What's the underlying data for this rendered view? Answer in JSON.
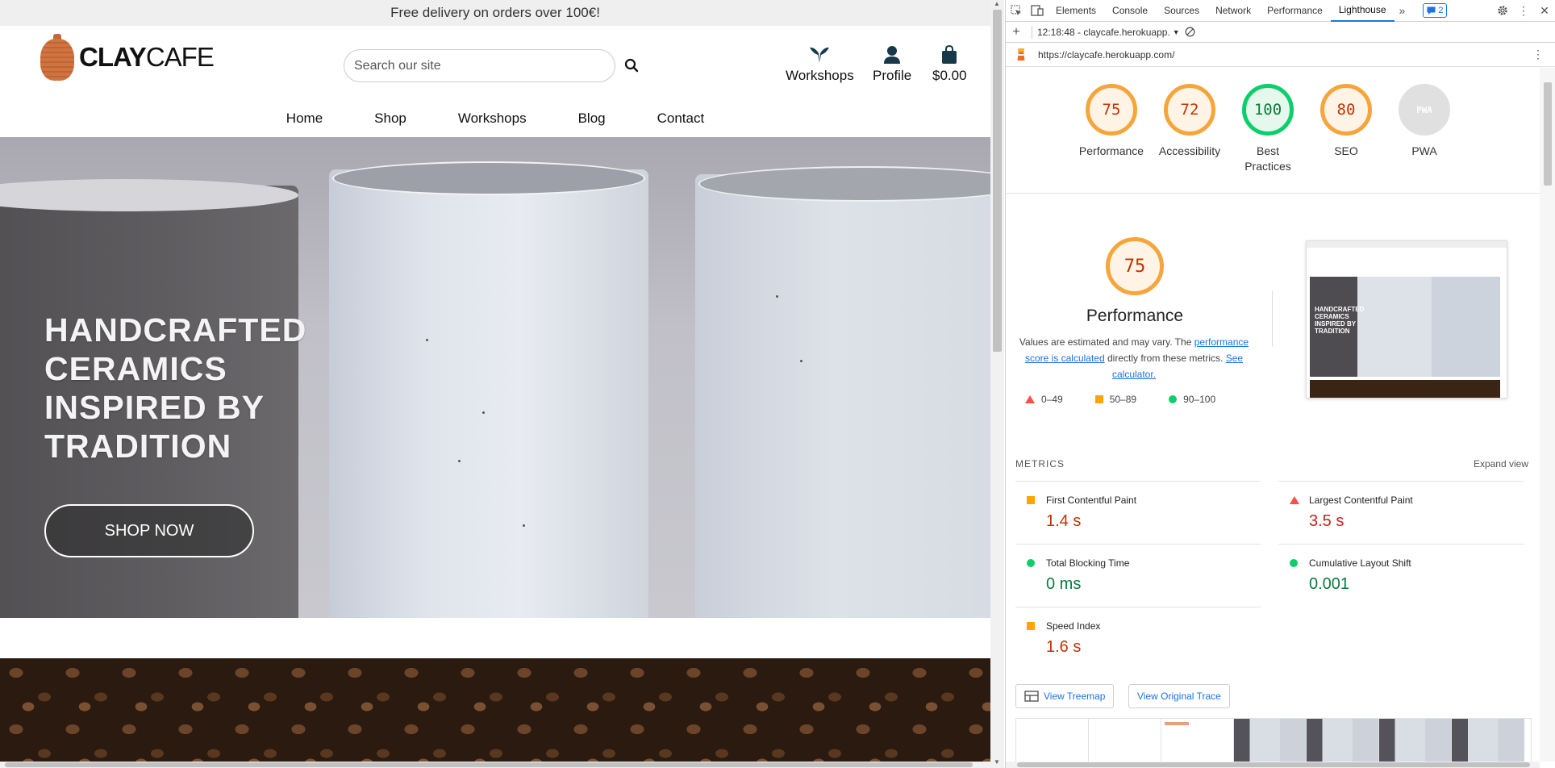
{
  "site": {
    "banner": "Free delivery on orders over 100€!",
    "logo": {
      "bold": "CLAY",
      "light": "CAFE"
    },
    "search": {
      "placeholder": "Search our site"
    },
    "actions": {
      "workshops": "Workshops",
      "profile": "Profile",
      "bag_total": "$0.00"
    },
    "nav": [
      "Home",
      "Shop",
      "Workshops",
      "Blog",
      "Contact"
    ],
    "hero": {
      "title_lines": [
        "HANDCRAFTED",
        "CERAMICS",
        "INSPIRED BY",
        "TRADITION"
      ],
      "cta": "SHOP NOW"
    }
  },
  "devtools": {
    "tabs": [
      "Elements",
      "Console",
      "Sources",
      "Network",
      "Performance",
      "Lighthouse"
    ],
    "active_tab": "Lighthouse",
    "issues_count": "2",
    "report_selector": "12:18:48 - claycafe.herokuapp.",
    "url": "https://claycafe.herokuapp.com/",
    "gauges": [
      {
        "score": "75",
        "label": "Performance",
        "state": "avg"
      },
      {
        "score": "72",
        "label": "Accessibility",
        "state": "avg"
      },
      {
        "score": "100",
        "label": "Best Practices",
        "state": "good"
      },
      {
        "score": "80",
        "label": "SEO",
        "state": "avg"
      },
      {
        "score": "PWA",
        "label": "PWA",
        "state": "na"
      }
    ],
    "performance": {
      "score": "75",
      "title": "Performance",
      "desc_prefix": "Values are estimated and may vary. The ",
      "desc_link1": "performance score is calculated",
      "desc_mid": " directly from these metrics. ",
      "desc_link2": "See calculator."
    },
    "legend": [
      "0–49",
      "50–89",
      "90–100"
    ],
    "thumbnail_text": "HANDCRAFTED CERAMICS INSPIRED BY TRADITION",
    "metrics_header": "METRICS",
    "expand_view": "Expand view",
    "metrics": [
      {
        "name": "First Contentful Paint",
        "value": "1.4 s",
        "state": "avg"
      },
      {
        "name": "Largest Contentful Paint",
        "value": "3.5 s",
        "state": "bad"
      },
      {
        "name": "Total Blocking Time",
        "value": "0 ms",
        "state": "good"
      },
      {
        "name": "Cumulative Layout Shift",
        "value": "0.001",
        "state": "good"
      },
      {
        "name": "Speed Index",
        "value": "1.6 s",
        "state": "avg"
      }
    ],
    "buttons": {
      "treemap": "View Treemap",
      "trace": "View Original Trace"
    }
  },
  "colors": {
    "accent": "#1a73e8",
    "avg": "#f5a53b",
    "good": "#0cce6b",
    "bad": "#ff4e42",
    "brand_clay": "#c2683a"
  }
}
